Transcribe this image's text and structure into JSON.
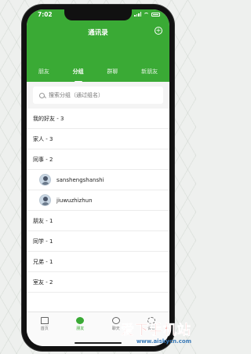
{
  "status_bar": {
    "time": "7:02"
  },
  "header": {
    "title": "通讯录",
    "add_icon": "plus-circle-icon"
  },
  "tabs": [
    {
      "label": "朋友",
      "active": false
    },
    {
      "label": "分组",
      "active": true
    },
    {
      "label": "群聊",
      "active": false
    },
    {
      "label": "新朋友",
      "active": false
    }
  ],
  "search": {
    "placeholder": "搜索分组（通过组名）"
  },
  "list": {
    "group_1": "我的好友 - 3",
    "group_2": "家人 - 3",
    "group_3": "同事 - 2",
    "contact_1": "sanshengshanshi",
    "contact_2": "jiuwuzhizhun",
    "group_4": "朋友 - 1",
    "group_5": "同学 - 1",
    "group_6": "兄弟 - 1",
    "group_7": "室友 - 2"
  },
  "tabbar": [
    {
      "label": "首页",
      "icon": "home-icon"
    },
    {
      "label": "朋友",
      "icon": "friends-icon"
    },
    {
      "label": "聊天",
      "icon": "chat-icon"
    },
    {
      "label": "设置",
      "icon": "settings-icon"
    }
  ],
  "watermark": {
    "text": "爱下手机站",
    "url": "www.aiskycn.com"
  },
  "colors": {
    "accent": "#3aaa35",
    "watermark_red": "#e8554f",
    "watermark_blue": "#3a7ab8"
  }
}
